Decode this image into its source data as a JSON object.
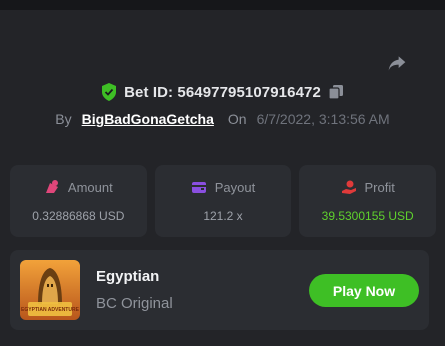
{
  "bet": {
    "id_label": "Bet ID: 56497795107916472",
    "by_label": "By",
    "username": "BigBadGonaGetcha",
    "on_label": "On",
    "date": "6/7/2022, 3:13:56 AM"
  },
  "stats": [
    {
      "label": "Amount",
      "value": "0.32886868 USD",
      "icon": "coins-icon",
      "color": "#e0467a"
    },
    {
      "label": "Payout",
      "value": "121.2 x",
      "icon": "wallet-icon",
      "color": "#8a4fe0"
    },
    {
      "label": "Profit",
      "value": "39.5300155 USD",
      "icon": "profit-hand-icon",
      "color": "#e03a3a"
    }
  ],
  "game": {
    "name": "Egyptian",
    "provider": "BC Original",
    "thumb_text": "EGYPTIAN ADVENTURE",
    "play_label": "Play Now"
  },
  "colors": {
    "accent_green": "#3ebf25",
    "profit_green": "#5fd12d",
    "shield_green": "#3ebf25"
  }
}
